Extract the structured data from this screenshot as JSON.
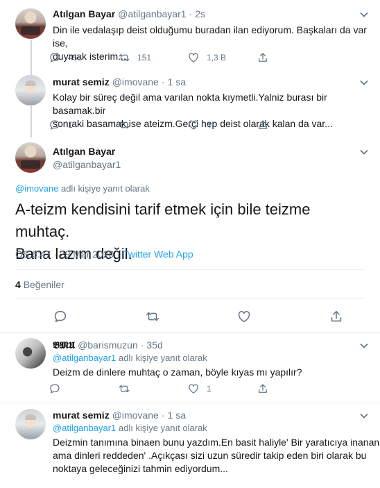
{
  "tweets": [
    {
      "name": "Atılgan Bayar",
      "handle": "@atilganbayar1",
      "sep": "·",
      "time": "2s",
      "text_lines": [
        "Din ile vedalaşıp deist olduğumu buradan ilan ediyorum. Başkaları da var ise,",
        "duymak isterim..."
      ],
      "replies": "458",
      "retweets": "151",
      "likes": "1,3 B"
    },
    {
      "name": "murat semiz",
      "handle": "@imovane",
      "sep": "·",
      "time": "1 sa",
      "text_lines": [
        "Kolay bir süreç değil ama varılan nokta kıymetli.Yalniz burası bir basamak.bir",
        "sonraki basamak ise ateizm.Gerçi hep deist olarak kalan da var..."
      ],
      "replies": "1",
      "retweets": "",
      "likes": "4"
    }
  ],
  "main_tweet": {
    "name": "Atılgan Bayar",
    "handle": "@atilganbayar1",
    "reply_link": "@imovane",
    "reply_suffix": "adlı kişiye yanıt olarak",
    "text_lines": [
      "A-teizm kendisini tarif etmek için bile teizme muhtaç.",
      "Bana lazım değil."
    ],
    "time": "ÖS 6:47 · 29 Mar 2020 ·",
    "app": "Twitter Web App",
    "likes_count": "4",
    "likes_label": "Beğeniler"
  },
  "replies": [
    {
      "name": "𝕭𝕸𝖀",
      "handle": "@barismuzun",
      "sep": "·",
      "time": "35d",
      "reply_link": "@atilganbayar1",
      "reply_suffix": "adlı kişiye yanıt olarak",
      "text_lines": [
        "Deizm de dinlere muhtaç o zaman, böyle kıyas mı yapılır?"
      ],
      "replies": "",
      "retweets": "",
      "likes": "1"
    },
    {
      "name": "murat semiz",
      "handle": "@imovane",
      "sep": "·",
      "time": "1 sa",
      "reply_link": "@atilganbayar1",
      "reply_suffix": "adlı kişiye yanıt olarak",
      "text_lines": [
        "Deizmin tanımına binaen bunu yazdım.En basit haliyle' Bir yaratıcıya inanan",
        "ama dinleri reddeden' .Açıkçası sizi uzun süredir takip eden biri olarak bu",
        "noktaya geleceğinizi tahmin ediyordum..."
      ]
    }
  ]
}
